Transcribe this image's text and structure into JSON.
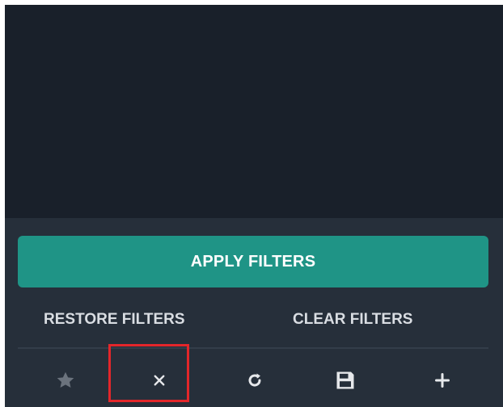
{
  "panel": {
    "apply_label": "APPLY FILTERS",
    "restore_label": "RESTORE FILTERS",
    "clear_label": "CLEAR FILTERS"
  },
  "toolbar": {
    "icons": [
      "star-icon",
      "close-icon",
      "refresh-icon",
      "save-icon",
      "add-icon"
    ]
  },
  "colors": {
    "background": "#19202a",
    "panel": "#262f3a",
    "accent": "#1f9486",
    "highlight": "#e3262a",
    "icon_muted": "#6b737d",
    "icon": "#e6e8eb"
  }
}
